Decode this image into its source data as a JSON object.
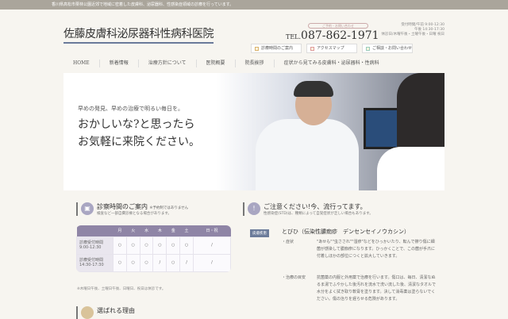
{
  "topbar": "香川県高松市栗林公園近郊で地域に密着した皮膚科、泌尿器科、性感染症領域の診療を行っています。",
  "header": {
    "logo": "佐藤皮膚科泌尿器科性病科医院",
    "tel_note": "ご予約・お問い合わせ",
    "tel_prefix": "TEL.",
    "tel": "087-862-1971",
    "hours": [
      "受付時間/午前 9:00-12:30",
      "午後 14:30-17:30",
      "休診日/木曜午後・土曜午後・日曜 祝日"
    ],
    "buttons": [
      "診療時間のご案内",
      "アクセスマップ",
      "ご相談・お問い合わせ"
    ]
  },
  "nav": [
    "HOME",
    "新着情報",
    "治療方針について",
    "医院概要",
    "院長挨拶",
    "症状から見てみる皮膚科・泌尿器科・性病科"
  ],
  "hero": {
    "small": "早めの発見、早めの治療で明るい毎日を。",
    "line1": "おかしいな?と思ったら",
    "line2": "お気軽に来院ください。"
  },
  "schedule": {
    "title": "診察時間のご案内",
    "note": "※予約制ではありません",
    "sub": "検査など一部自費診療となる場合があります。",
    "days": [
      "月",
      "火",
      "水",
      "木",
      "金",
      "土",
      "日・祝"
    ],
    "rows": [
      {
        "label1": "診療受付時間",
        "label2": "9:00-12:30",
        "cells": [
          "○",
          "○",
          "○",
          "○",
          "○",
          "○",
          "/"
        ]
      },
      {
        "label1": "診療受付時間",
        "label2": "14:30-17:30",
        "cells": [
          "○",
          "○",
          "○",
          "/",
          "○",
          "/",
          "/"
        ]
      }
    ],
    "footnote": "※木曜日午後、土曜日午後、日曜日、祝日は休診です。"
  },
  "reasons": {
    "title": "選ばれる理由"
  },
  "alert": {
    "title": "ご注意ください!今、流行ってます。",
    "sub": "性感染症(STD)は、種類によって自覚症状が乏しい場合もあります。",
    "badge": "皮膚疾患",
    "disease": "とびひ（伝染性膿痂疹　デンセンセイノウカシン）",
    "items": [
      {
        "k": "・症状",
        "v": "\"あせも\"\"虫さされ\"\"湿疹\"などをひっかいたり、転んで擦り傷に細菌が感染して膿痂疹になります。ひっかくことで、この菌が手爪に付着しほかの部位につくと拡大していきます。"
      },
      {
        "k": "・治療の目安",
        "v": "抗菌薬の内服と外用薬で治療を行います。傷口は、毎日、清潔なぬるま湯でふやかした後汚れを流水で洗い流した後、清潔なタオルで水分をよく拭き取り軟膏を塗ります。決して消毒薬は塗らないでください。傷の治りを遅らせる危険があります。"
      }
    ]
  }
}
